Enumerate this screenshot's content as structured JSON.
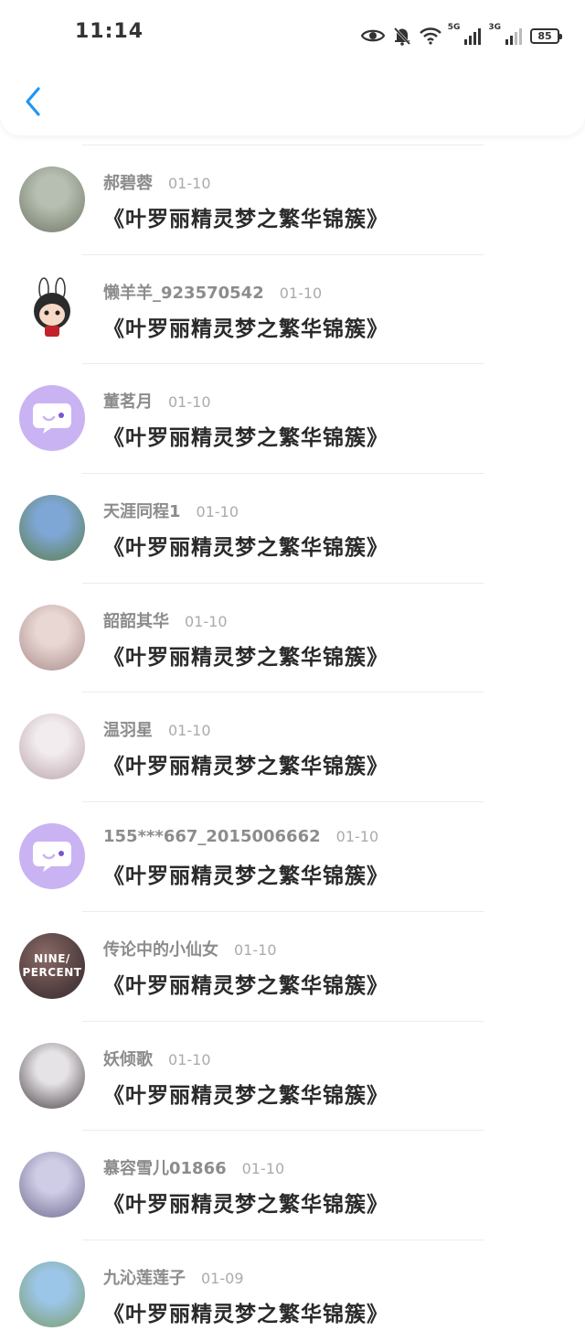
{
  "status_bar": {
    "time": "11:14",
    "network_5g": "5G",
    "network_3g": "3G",
    "battery": "85",
    "icons": [
      "eye-icon",
      "bell-off-icon",
      "wifi-icon",
      "signal-icon",
      "signal-icon",
      "battery-icon"
    ]
  },
  "header": {
    "back_icon": "chevron-left-icon"
  },
  "colors": {
    "accent": "#2196f3",
    "default_avatar": "#c9b3f3",
    "username": "#8c8c8c",
    "date": "#ababab",
    "title": "#2a2a2a"
  },
  "list": {
    "items": [
      {
        "name": "郝碧蓉",
        "date": "01-10",
        "title": "《叶罗丽精灵梦之繁华锦簇》",
        "avatar": "photo"
      },
      {
        "name": "懒羊羊_923570542",
        "date": "01-10",
        "title": "《叶罗丽精灵梦之繁华锦簇》",
        "avatar": "cartoon"
      },
      {
        "name": "董茗月",
        "date": "01-10",
        "title": "《叶罗丽精灵梦之繁华锦簇》",
        "avatar": "default"
      },
      {
        "name": "天涯同程1",
        "date": "01-10",
        "title": "《叶罗丽精灵梦之繁华锦簇》",
        "avatar": "photo"
      },
      {
        "name": "韶韶其华",
        "date": "01-10",
        "title": "《叶罗丽精灵梦之繁华锦簇》",
        "avatar": "photo"
      },
      {
        "name": "温羽星",
        "date": "01-10",
        "title": "《叶罗丽精灵梦之繁华锦簇》",
        "avatar": "photo"
      },
      {
        "name": "155***667_2015006662",
        "date": "01-10",
        "title": "《叶罗丽精灵梦之繁华锦簇》",
        "avatar": "default"
      },
      {
        "name": "传论中的小仙女",
        "date": "01-10",
        "title": "《叶罗丽精灵梦之繁华锦簇》",
        "avatar": "text",
        "avatar_lines": [
          "NINE/",
          "PERCENT"
        ]
      },
      {
        "name": "妖倾歌",
        "date": "01-10",
        "title": "《叶罗丽精灵梦之繁华锦簇》",
        "avatar": "photo"
      },
      {
        "name": "慕容雪儿01866",
        "date": "01-10",
        "title": "《叶罗丽精灵梦之繁华锦簇》",
        "avatar": "photo"
      },
      {
        "name": "九沁莲莲子",
        "date": "01-09",
        "title": "《叶罗丽精灵梦之繁华锦簇》",
        "avatar": "photo"
      }
    ]
  }
}
